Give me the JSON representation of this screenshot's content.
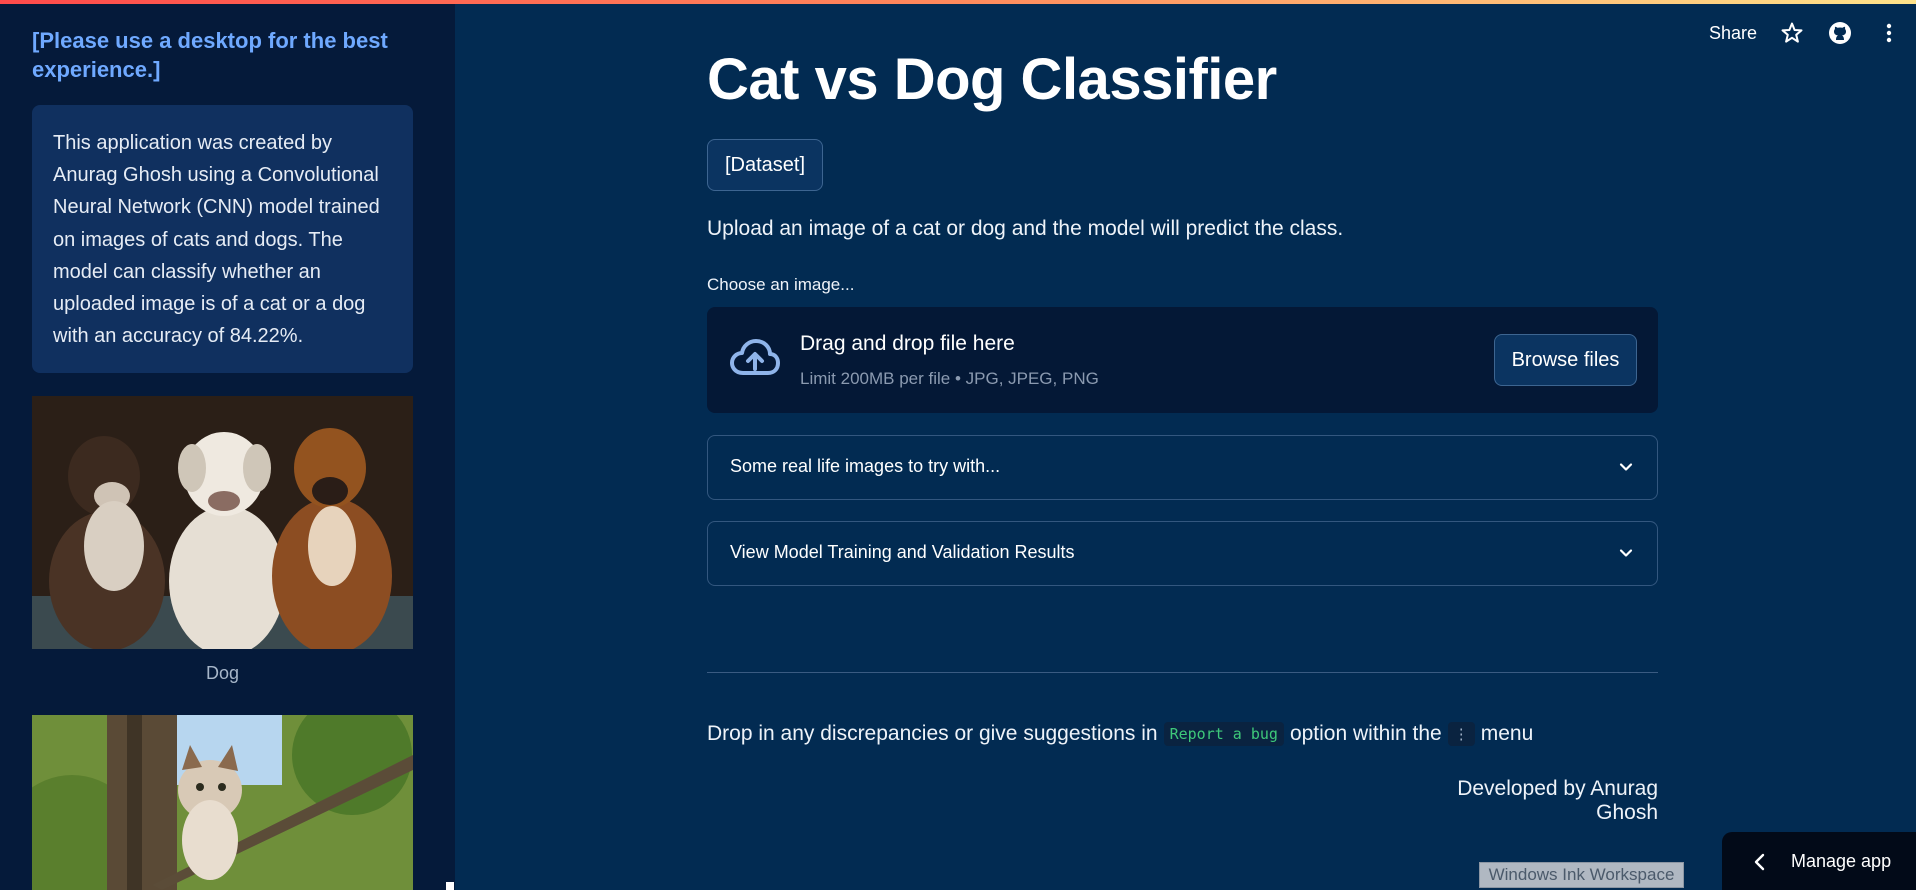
{
  "sidebar": {
    "note": "[Please use a desktop for the best experience.]",
    "about": "This application was created by Anurag Ghosh using a Convolutional Neural Network (CNN) model trained on images of cats and dogs. The model can classify whether an uploaded image is of a cat or a dog with an accuracy of 84.22%.",
    "images": [
      {
        "caption": "Dog"
      },
      {
        "caption": ""
      }
    ]
  },
  "header": {
    "share_label": "Share",
    "icons": [
      "star-icon",
      "github-icon",
      "more-vertical-icon"
    ]
  },
  "main": {
    "title": "Cat vs Dog Classifier",
    "dataset_button": "[Dataset]",
    "intro": "Upload an image of a cat or dog and the model will predict the class.",
    "uploader": {
      "label": "Choose an image...",
      "drop_title": "Drag and drop file here",
      "limit": "Limit 200MB per file • JPG, JPEG, PNG",
      "browse_label": "Browse files"
    },
    "expanders": [
      {
        "label": "Some real life images to try with..."
      },
      {
        "label": "View Model Training and Validation Results"
      }
    ],
    "footer": {
      "prefix": "Drop in any discrepancies or give suggestions in",
      "code": "Report a bug",
      "middle": "option within the",
      "menu_code": "⋮",
      "suffix": "menu",
      "developed_by": "Developed by Anurag Ghosh"
    }
  },
  "overlay": {
    "ink_workspace": "Windows Ink Workspace",
    "manage_app": "Manage app"
  },
  "colors": {
    "background": "#022b52",
    "sidebar": "#051a3a",
    "accent_note": "#6fa9ff",
    "code_text": "#3ec97a"
  }
}
